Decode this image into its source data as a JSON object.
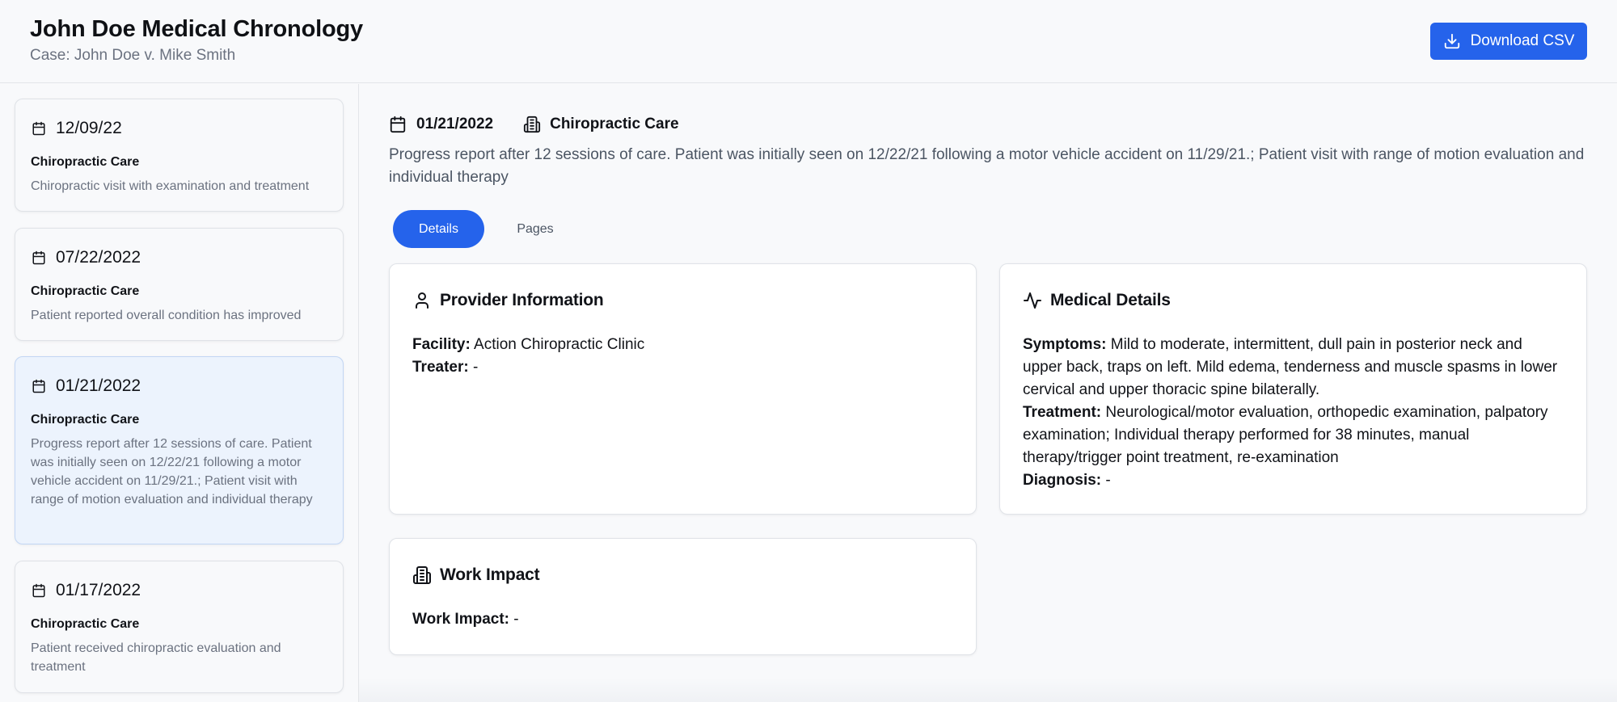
{
  "header": {
    "title": "John Doe Medical Chronology",
    "subtitle": "Case: John Doe v. Mike Smith",
    "download_label": "Download CSV"
  },
  "sidebar": {
    "entries": [
      {
        "date": "12/09/22",
        "type": "Chiropractic Care",
        "description": "Chiropractic visit with examination and treatment"
      },
      {
        "date": "07/22/2022",
        "type": "Chiropractic Care",
        "description": "Patient reported overall condition has improved"
      },
      {
        "date": "01/21/2022",
        "type": "Chiropractic Care",
        "description": "Progress report after 12 sessions of care. Patient was initially seen on 12/22/21 following a motor vehicle accident on 11/29/21.; Patient visit with range of motion evaluation and individual therapy",
        "selected": true
      },
      {
        "date": "01/17/2022",
        "type": "Chiropractic Care",
        "description": "Patient received chiropractic evaluation and treatment"
      }
    ]
  },
  "main": {
    "date": "01/21/2022",
    "type": "Chiropractic Care",
    "description": "Progress report after 12 sessions of care. Patient was initially seen on 12/22/21 following a motor vehicle accident on 11/29/21.; Patient visit with range of motion evaluation and individual therapy",
    "tabs": [
      {
        "label": "Details",
        "active": true
      },
      {
        "label": "Pages",
        "active": false
      }
    ],
    "provider": {
      "title": "Provider Information",
      "facility_label": "Facility:",
      "facility": "Action Chiropractic Clinic",
      "treater_label": "Treater:",
      "treater": "-"
    },
    "medical": {
      "title": "Medical Details",
      "symptoms_label": "Symptoms:",
      "symptoms": "Mild to moderate, intermittent, dull pain in posterior neck and upper back, traps on left. Mild edema, tenderness and muscle spasms in lower cervical and upper thoracic spine bilaterally.",
      "treatment_label": "Treatment:",
      "treatment": "Neurological/motor evaluation, orthopedic examination, palpatory examination; Individual therapy performed for 38 minutes, manual therapy/trigger point treatment, re-examination",
      "diagnosis_label": "Diagnosis:",
      "diagnosis": "-"
    },
    "work": {
      "title": "Work Impact",
      "work_label": "Work Impact:",
      "work": "-"
    }
  },
  "icons": {
    "calendar": "calendar-icon",
    "building": "building-icon",
    "user": "user-icon",
    "activity": "activity-icon",
    "download": "download-icon"
  },
  "colors": {
    "accent": "#2563eb",
    "selected_bg": "#ecf3fd",
    "muted_text": "#6b7280"
  }
}
